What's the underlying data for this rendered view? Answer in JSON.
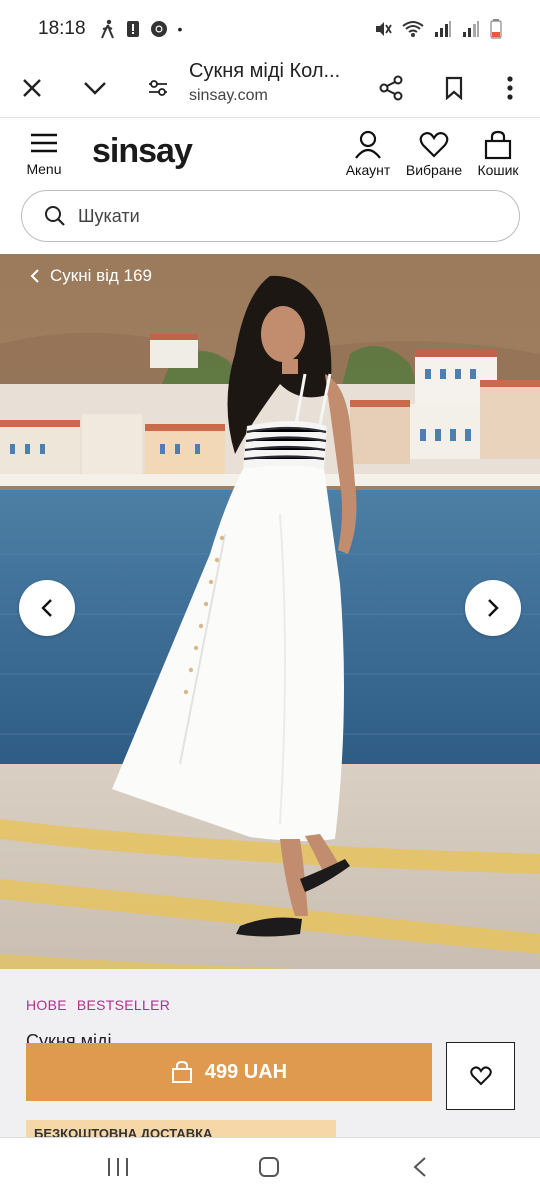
{
  "status_bar": {
    "time": "18:18"
  },
  "browser": {
    "page_title": "Сукня міді Кол...",
    "domain": "sinsay.com"
  },
  "header": {
    "menu_label": "Menu",
    "logo": "sinsay",
    "account_label": "Акаунт",
    "wishlist_label": "Вибране",
    "cart_label": "Кошик"
  },
  "search": {
    "placeholder": "Шукати"
  },
  "hero": {
    "breadcrumb": "Сукні від 169"
  },
  "product": {
    "badge_new": "НОВЕ",
    "badge_bestseller": "BESTSELLER",
    "name": "Сукня міді",
    "price_button": "499 UAH",
    "promo_banner": "БЕЗКОШТОВНА ДОСТАВКА"
  },
  "colors": {
    "accent": "#df9a4f",
    "badge": "#b0308f",
    "promo": "#f6d7a8"
  }
}
